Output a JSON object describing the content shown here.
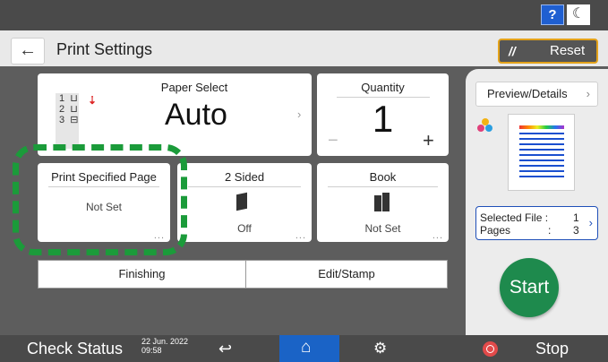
{
  "header": {
    "title": "Print Settings",
    "reset_label": "Reset",
    "help_label": "?"
  },
  "paper_select": {
    "label": "Paper Select",
    "value": "Auto",
    "trays": [
      "1",
      "2",
      "3"
    ]
  },
  "quantity": {
    "label": "Quantity",
    "value": "1",
    "minus": "−",
    "plus": "+"
  },
  "print_specified_page": {
    "label": "Print Specified Page",
    "value": "Not Set"
  },
  "two_sided": {
    "label": "2 Sided",
    "value": "Off"
  },
  "book": {
    "label": "Book",
    "value": "Not Set"
  },
  "finishing": {
    "label": "Finishing"
  },
  "edit_stamp": {
    "label": "Edit/Stamp"
  },
  "side": {
    "preview_label": "Preview/Details",
    "selected_file_label": "Selected File :",
    "selected_file_value": "1",
    "pages_label": "Pages",
    "pages_colon": ":",
    "pages_value": "3",
    "start_label": "Start"
  },
  "bottom": {
    "check_status": "Check Status",
    "date": "22 Jun. 2022",
    "time": "09:58",
    "stop_label": "Stop"
  },
  "colors": {
    "highlight": "#1b9b3a",
    "start": "#1e8a4d",
    "home": "#1a63c6",
    "reset_border": "#e3a21a",
    "help": "#1f5fd1"
  }
}
